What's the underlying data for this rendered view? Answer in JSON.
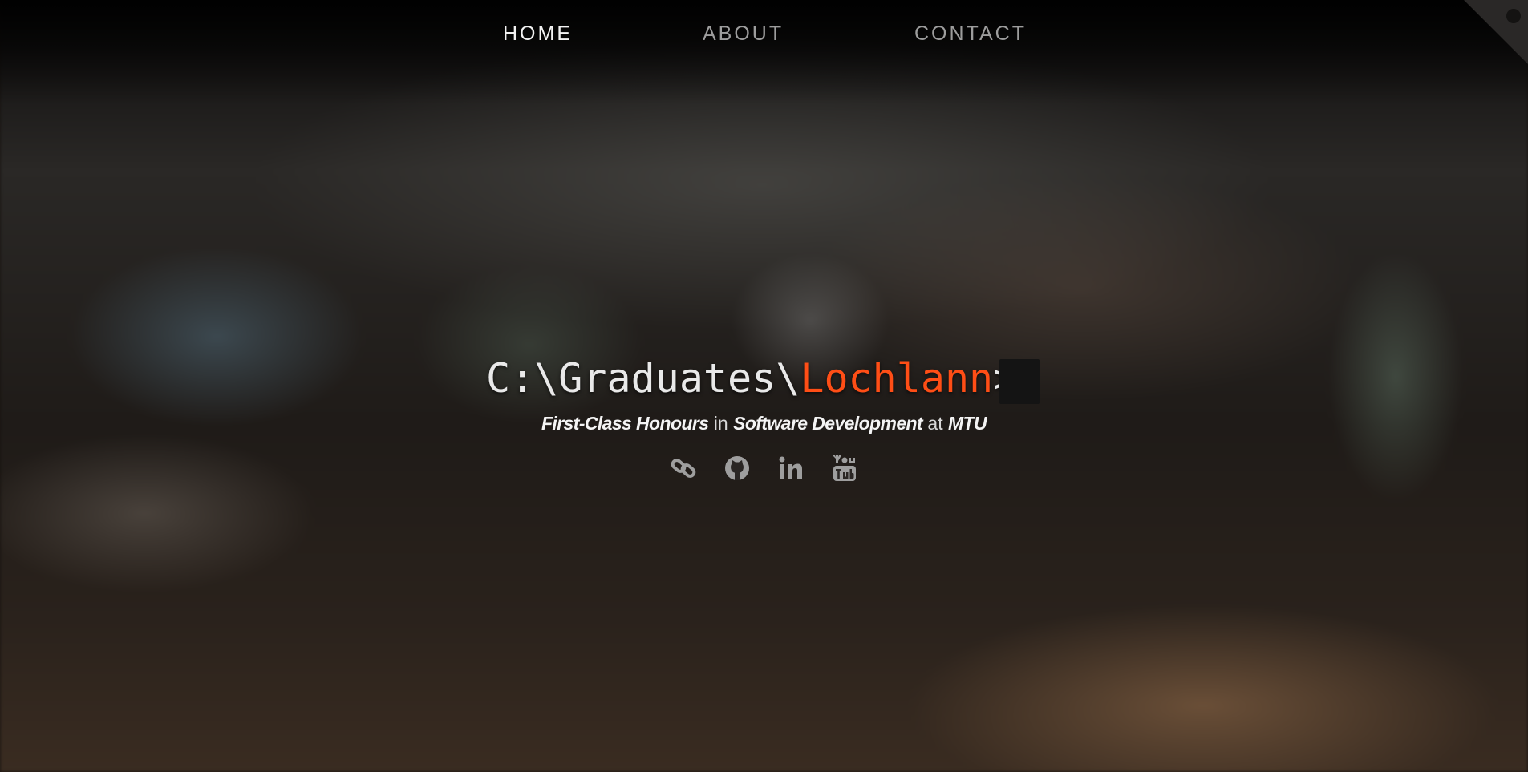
{
  "nav": {
    "items": [
      {
        "label": "HOME",
        "active": true
      },
      {
        "label": "ABOUT",
        "active": false
      },
      {
        "label": "CONTACT",
        "active": false
      }
    ]
  },
  "hero": {
    "prompt_path": "C:\\Graduates\\",
    "prompt_name": "Lochlann",
    "prompt_suffix": ">",
    "tagline": {
      "degree": "First-Class Honours",
      "in_word": "in",
      "field": "Software Development",
      "at_word": "at",
      "school": "MTU"
    }
  },
  "socials": [
    {
      "icon": "link-icon"
    },
    {
      "icon": "github-icon"
    },
    {
      "icon": "linkedin-icon"
    },
    {
      "icon": "youtube-icon"
    }
  ],
  "colors": {
    "accent": "#ff4e16",
    "nav_active": "#f2f2f2",
    "nav_inactive": "#9d9d9d"
  }
}
